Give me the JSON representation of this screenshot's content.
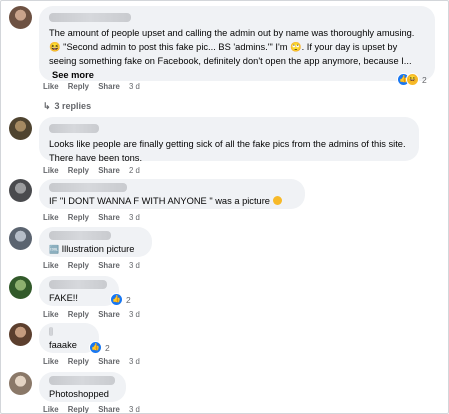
{
  "comments": [
    {
      "text": "The amount of people upset and calling the admin out by name was thoroughly amusing. 😆 \"Second admin to post this fake pic... BS 'admins.'\" I'm 🙄. If your day is upset by seeing something fake on Facebook, definitely don't open the app anymore, because I...",
      "see_more": "See more",
      "like": "Like",
      "reply": "Reply",
      "share": "Share",
      "time": "3 d",
      "reaction_count": "2",
      "avatar_color": "#8a6e5e"
    },
    {
      "text": "Looks like people are finally getting sick of all the fake pics from the admins of this site. There have been tons.",
      "like": "Like",
      "reply": "Reply",
      "share": "Share",
      "time": "2 d",
      "avatar_color": "#6b5a3e"
    },
    {
      "text": "IF \"I DONT WANNA F WITH ANYONE \" was a picture",
      "like": "Like",
      "reply": "Reply",
      "share": "Share",
      "time": "3 d",
      "avatar_color": "#5f6165"
    },
    {
      "text": "Illustration picture",
      "prefix_icon": "🆒",
      "like": "Like",
      "reply": "Reply",
      "share": "Share",
      "time": "3 d",
      "avatar_color": "#7a8392"
    },
    {
      "text": "FAKE!!",
      "like": "Like",
      "reply": "Reply",
      "share": "Share",
      "time": "3 d",
      "reaction_count": "2",
      "avatar_color": "#4e7a3e"
    },
    {
      "text": "faaake",
      "like": "Like",
      "reply": "Reply",
      "share": "Share",
      "time": "3 d",
      "reaction_count": "2",
      "avatar_color": "#7d5c48"
    },
    {
      "text": "Photoshopped",
      "like": "Like",
      "reply": "Reply",
      "share": "Share",
      "time": "3 d",
      "avatar_color": "#a39182"
    }
  ],
  "replies_link": "3 replies",
  "colors": {
    "accent": "#1877f2",
    "bubble": "#f0f2f5",
    "meta": "#65676b"
  }
}
